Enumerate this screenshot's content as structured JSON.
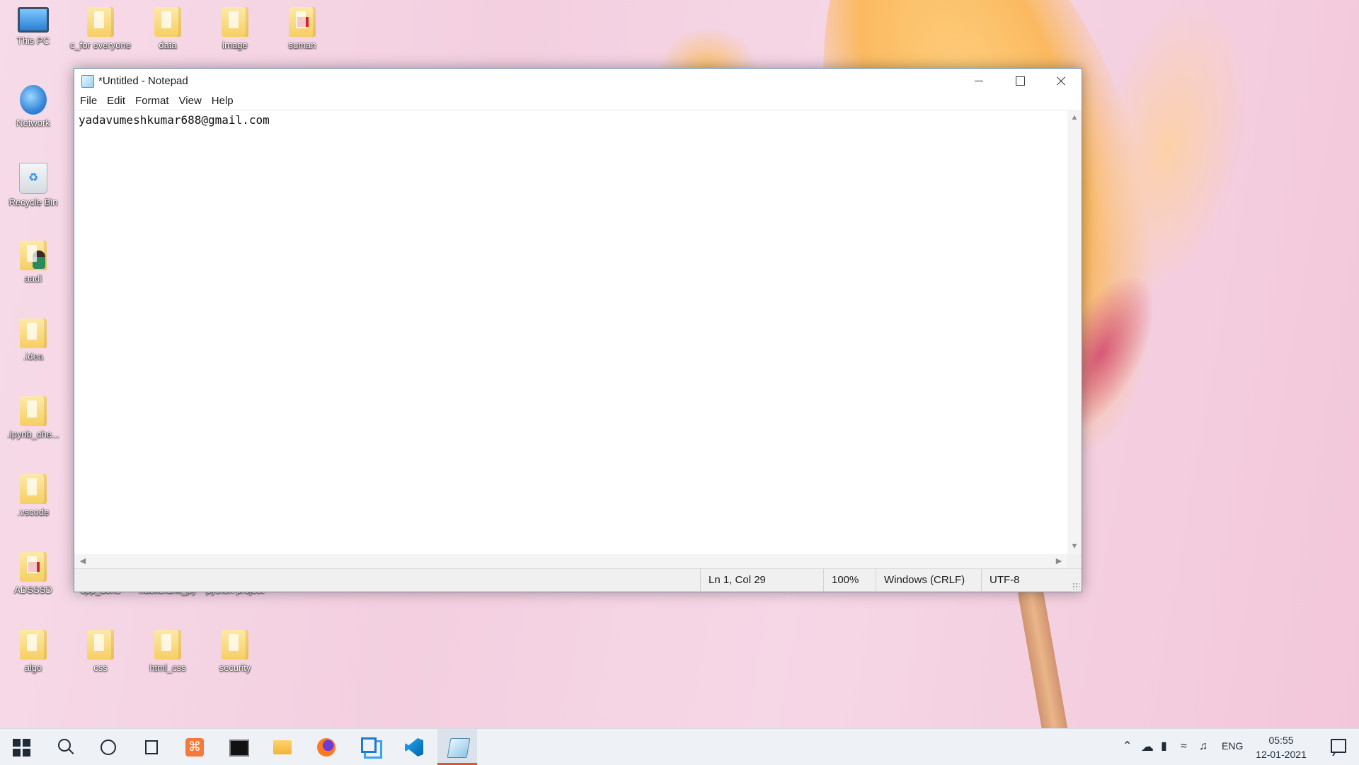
{
  "desktop": {
    "icons": [
      {
        "label": "This PC",
        "icon": "computer-icon"
      },
      {
        "label": "c_for everyone",
        "icon": "folder-icon"
      },
      {
        "label": "data",
        "icon": "folder-icon"
      },
      {
        "label": "image",
        "icon": "folder-icon"
      },
      {
        "label": "suman",
        "icon": "pdf-folder-icon"
      },
      {
        "label": "Network",
        "icon": "network-icon"
      },
      {
        "label": "Recycle Bin",
        "icon": "recycle-bin-icon"
      },
      {
        "label": "aadi",
        "icon": "user-folder-icon"
      },
      {
        "label": ".idea",
        "icon": "folder-icon"
      },
      {
        "label": ".ipynb_che...",
        "icon": "folder-icon"
      },
      {
        "label": ".vscode",
        "icon": "folder-icon"
      },
      {
        "label": "ADSSSD",
        "icon": "pdf-folder-icon"
      },
      {
        "label": "cpp_dohs",
        "icon": "folder-icon"
      },
      {
        "label": "hackerank_py",
        "icon": "folder-icon"
      },
      {
        "label": "python project",
        "icon": "folder-icon"
      },
      {
        "label": "algo",
        "icon": "folder-icon"
      },
      {
        "label": "css",
        "icon": "folder-icon"
      },
      {
        "label": "html_css",
        "icon": "folder-icon"
      },
      {
        "label": "security",
        "icon": "folder-icon"
      }
    ]
  },
  "window": {
    "title": "*Untitled - Notepad",
    "menu": [
      "File",
      "Edit",
      "Format",
      "View",
      "Help"
    ],
    "content": "yadavumeshkumar688@gmail.com",
    "status": {
      "position": "Ln 1, Col 29",
      "zoom": "100%",
      "line_ending": "Windows (CRLF)",
      "encoding": "UTF-8"
    }
  },
  "taskbar": {
    "apps": [
      "start-icon",
      "search-icon",
      "cortana-icon",
      "task-view-icon",
      "xampp-icon",
      "terminal-icon",
      "file-explorer-icon",
      "firefox-icon",
      "remote-desktop-icon",
      "vscode-icon",
      "notepad-icon"
    ],
    "active_app": "notepad-icon",
    "tray": {
      "language": "ENG",
      "time": "05:55",
      "date": "12-01-2021"
    }
  },
  "colors": {
    "taskbar_active_indicator": "#e2552b",
    "window_border": "#6f8fb7"
  }
}
